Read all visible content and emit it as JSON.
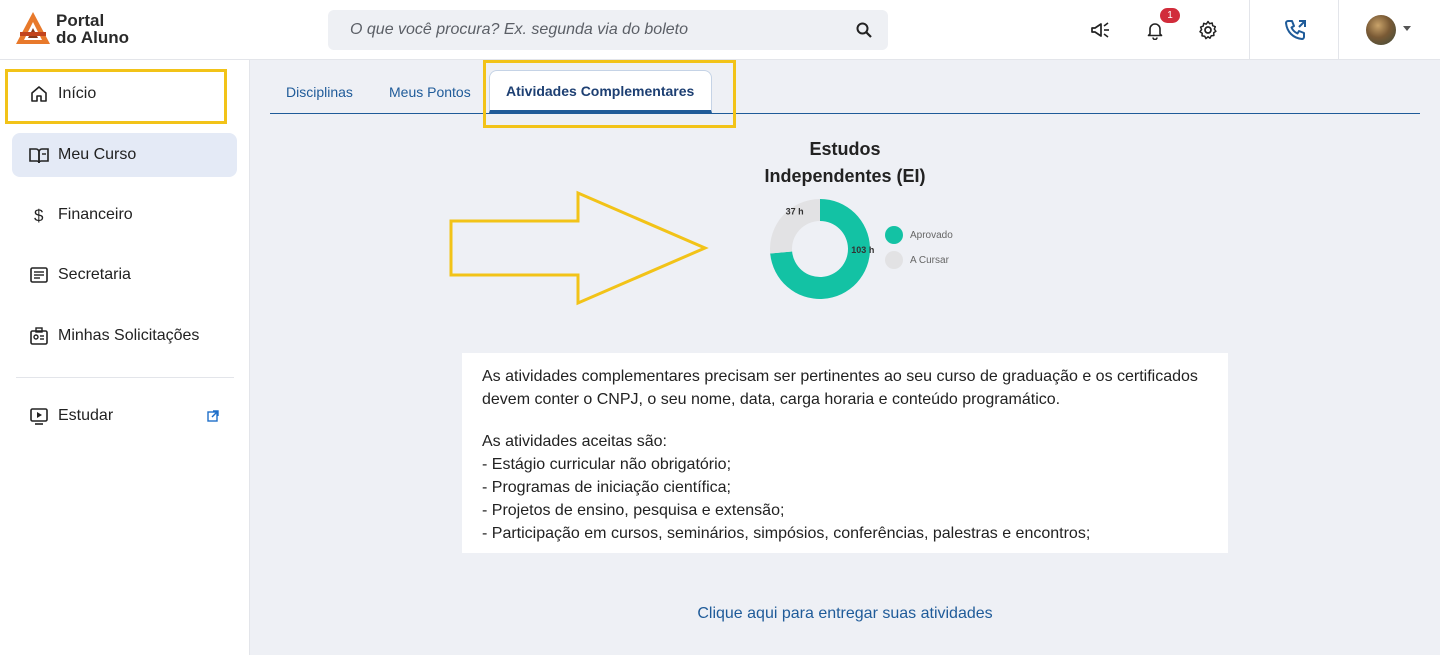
{
  "brand": {
    "line1": "Portal",
    "line2": "do Aluno"
  },
  "search": {
    "placeholder": "O que você procura? Ex. segunda via do boleto"
  },
  "header": {
    "notification_count": "1"
  },
  "sidebar": {
    "items": [
      {
        "label": "Início",
        "icon": "home-icon"
      },
      {
        "label": "Meu Curso",
        "icon": "book-icon"
      },
      {
        "label": "Financeiro",
        "icon": "dollar-icon"
      },
      {
        "label": "Secretaria",
        "icon": "document-list-icon"
      },
      {
        "label": "Minhas Solicitações",
        "icon": "badge-id-icon"
      },
      {
        "label": "Estudar",
        "icon": "play-screen-icon"
      }
    ]
  },
  "tabs": [
    {
      "label": "Disciplinas"
    },
    {
      "label": "Meus Pontos"
    },
    {
      "label": "Atividades Complementares"
    }
  ],
  "chart_data": {
    "type": "pie",
    "title": "Estudos Independentes (EI)",
    "title_lines": [
      "Estudos",
      "Independentes (EI)"
    ],
    "categories": [
      "Aprovado",
      "A Cursar"
    ],
    "values": [
      103,
      37
    ],
    "value_labels": [
      "103 h",
      "37 h"
    ],
    "colors": [
      "#13c2a4",
      "#e2e2e4"
    ],
    "legend_position": "right"
  },
  "info": {
    "paragraph1": "As atividades complementares precisam ser pertinentes ao seu curso de graduação e os certificados devem conter o CNPJ, o seu nome, data, carga horaria e conteúdo programático.",
    "list_intro": "As atividades aceitas são:",
    "list": [
      "- Estágio curricular não obrigatório;",
      "- Programas de iniciação científica;",
      "- Projetos de ensino, pesquisa e extensão;",
      "- Participação em cursos, seminários, simpósios, conferências, palestras e encontros;"
    ]
  },
  "links": {
    "submit": "Clique aqui para entregar suas atividades"
  },
  "colors": {
    "accent": "#1f5b99",
    "highlight": "#f2c318",
    "approved": "#13c2a4",
    "pending": "#e2e2e4"
  }
}
